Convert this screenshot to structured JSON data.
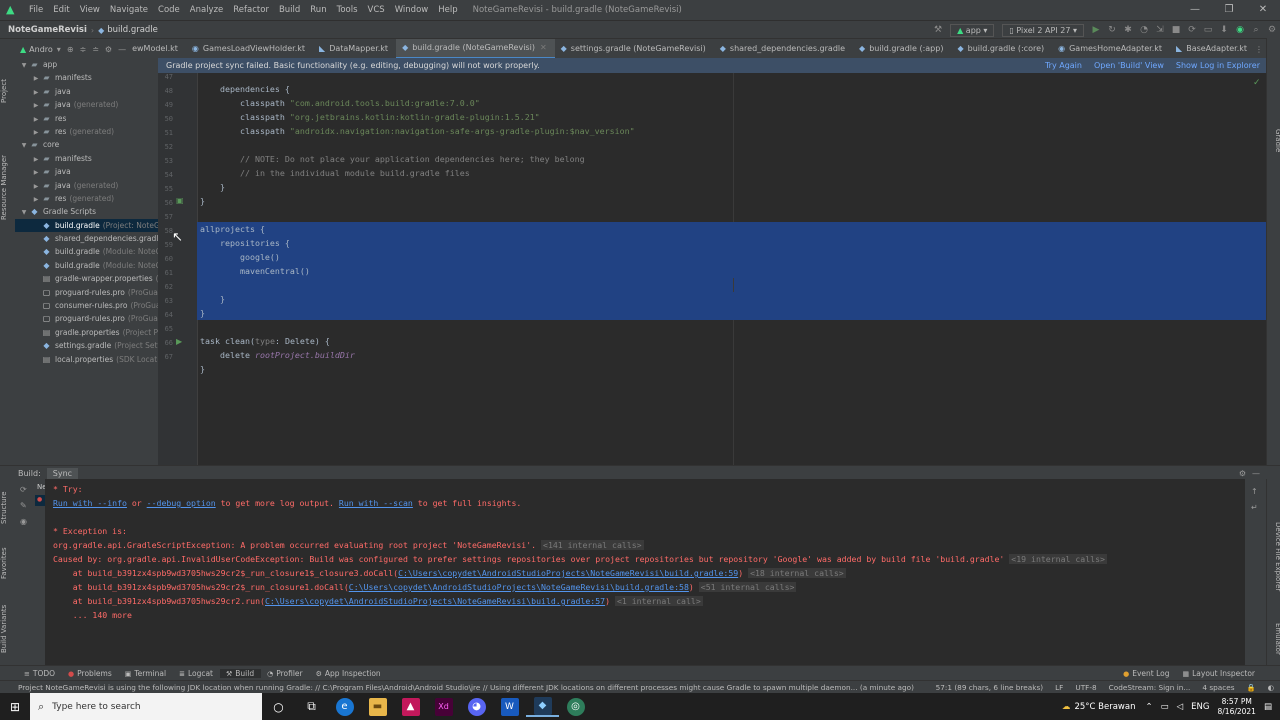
{
  "menubar": {
    "items": [
      "File",
      "Edit",
      "View",
      "Navigate",
      "Code",
      "Analyze",
      "Refactor",
      "Build",
      "Run",
      "Tools",
      "VCS",
      "Window",
      "Help"
    ],
    "window_title": "NoteGameRevisi - build.gradle (NoteGameRevisi)"
  },
  "navbar": {
    "project": "NoteGameRevisi",
    "file": "build.gradle",
    "run_config": "app",
    "device": "Pixel 2 API 27"
  },
  "project_panel": {
    "header": "Andro",
    "rows": [
      {
        "label": "app",
        "sub": "",
        "icon": "folder",
        "indent": 0,
        "expanded": true
      },
      {
        "label": "manifests",
        "sub": "",
        "icon": "folder",
        "indent": 1,
        "expanded": false
      },
      {
        "label": "java",
        "sub": "",
        "icon": "folder",
        "indent": 1,
        "expanded": false
      },
      {
        "label": "java",
        "sub": "(generated)",
        "icon": "folder",
        "indent": 1,
        "expanded": false
      },
      {
        "label": "res",
        "sub": "",
        "icon": "folder",
        "indent": 1,
        "expanded": false
      },
      {
        "label": "res",
        "sub": "(generated)",
        "icon": "folder",
        "indent": 1,
        "expanded": false
      },
      {
        "label": "core",
        "sub": "",
        "icon": "folder",
        "indent": 0,
        "expanded": true
      },
      {
        "label": "manifests",
        "sub": "",
        "icon": "folder",
        "indent": 1,
        "expanded": false
      },
      {
        "label": "java",
        "sub": "",
        "icon": "folder",
        "indent": 1,
        "expanded": false
      },
      {
        "label": "java",
        "sub": "(generated)",
        "icon": "folder",
        "indent": 1,
        "expanded": false
      },
      {
        "label": "res",
        "sub": "(generated)",
        "icon": "folder",
        "indent": 1,
        "expanded": false
      },
      {
        "label": "Gradle Scripts",
        "sub": "",
        "icon": "gradle",
        "indent": 0,
        "expanded": true
      },
      {
        "label": "build.gradle",
        "sub": "(Project: NoteGa",
        "icon": "gradle",
        "indent": 1,
        "selected": true
      },
      {
        "label": "shared_dependencies.gradle",
        "sub": "",
        "icon": "gradle",
        "indent": 1
      },
      {
        "label": "build.gradle",
        "sub": "(Module: NoteG",
        "icon": "gradle",
        "indent": 1
      },
      {
        "label": "build.gradle",
        "sub": "(Module: NoteG",
        "icon": "gradle",
        "indent": 1
      },
      {
        "label": "gradle-wrapper.properties",
        "sub": "(G",
        "icon": "props",
        "indent": 1
      },
      {
        "label": "proguard-rules.pro",
        "sub": "(ProGuar",
        "icon": "file",
        "indent": 1
      },
      {
        "label": "consumer-rules.pro",
        "sub": "(ProGua",
        "icon": "file",
        "indent": 1
      },
      {
        "label": "proguard-rules.pro",
        "sub": "(ProGuar",
        "icon": "file",
        "indent": 1
      },
      {
        "label": "gradle.properties",
        "sub": "(Project Pr",
        "icon": "props",
        "indent": 1
      },
      {
        "label": "settings.gradle",
        "sub": "(Project Settin",
        "icon": "gradle",
        "indent": 1
      },
      {
        "label": "local.properties",
        "sub": "(SDK Location",
        "icon": "props",
        "indent": 1
      }
    ]
  },
  "tabs": [
    {
      "label": "ewModel.kt",
      "icon": "K",
      "active": false
    },
    {
      "label": "GamesLoadViewHolder.kt",
      "icon": "C",
      "active": false
    },
    {
      "label": "DataMapper.kt",
      "icon": "K",
      "active": false
    },
    {
      "label": "build.gradle (NoteGameRevisi)",
      "icon": "G",
      "active": true
    },
    {
      "label": "settings.gradle (NoteGameRevisi)",
      "icon": "G",
      "active": false
    },
    {
      "label": "shared_dependencies.gradle",
      "icon": "G",
      "active": false
    },
    {
      "label": "build.gradle (:app)",
      "icon": "G",
      "active": false
    },
    {
      "label": "build.gradle (:core)",
      "icon": "G",
      "active": false
    },
    {
      "label": "GamesHomeAdapter.kt",
      "icon": "C",
      "active": false
    },
    {
      "label": "BaseAdapter.kt",
      "icon": "K",
      "active": false
    }
  ],
  "banner": {
    "text": "Gradle project sync failed. Basic functionality (e.g. editing, debugging) will not work properly.",
    "try_again": "Try Again",
    "open_build": "Open 'Build' View",
    "show_log": "Show Log in Explorer"
  },
  "editor": {
    "line_numbers": [
      "47",
      "48",
      "49",
      "50",
      "51",
      "52",
      "53",
      "54",
      "55",
      "56",
      "57",
      "58",
      "59",
      "60",
      "61",
      "62",
      "63",
      "64",
      "65",
      "66",
      "67"
    ],
    "lines": [
      {
        "pre": "    ",
        "kw": "dependencies",
        "rest": " {",
        "str": "",
        "tail": ""
      },
      {
        "pre": "        ",
        "kw": "",
        "rest": "classpath ",
        "str": "\"com.android.tools.build:gradle:7.0.0\"",
        "tail": ""
      },
      {
        "pre": "        ",
        "kw": "",
        "rest": "classpath ",
        "str": "\"org.jetbrains.kotlin:kotlin-gradle-plugin:1.5.21\"",
        "tail": ""
      },
      {
        "pre": "        ",
        "kw": "",
        "rest": "classpath ",
        "str": "\"androidx.navigation:navigation-safe-args-gradle-plugin:",
        "tail": "$nav_version\""
      }
    ],
    "comment1": "        // NOTE: Do not place your application dependencies here; they belong",
    "comment2": "        // in the individual module build.gradle files",
    "close_brace_4": "    }",
    "close_brace_0": "}",
    "allprojects": "allprojects {",
    "repositories": "    repositories {",
    "google": "        google()",
    "mavencentral": "        mavenCentral()",
    "repo_close": "    }",
    "all_close": "}",
    "task_kw": "task ",
    "task_name": "clean(",
    "task_param": "type",
    "task_rest": ": Delete) {",
    "delete_kw": "    delete ",
    "delete_val": "rootProject.buildDir",
    "task_close": "}"
  },
  "build_panel": {
    "title": "Build:",
    "sync_tab": "Sync",
    "try_label": "* Try:",
    "run_info_1": "Run with --info",
    "or": " or ",
    "run_debug": "--debug option",
    "more_log": " to get more log output. ",
    "run_scan": "Run with --scan",
    "full_insights": " to get full insights.",
    "exception_label": "* Exception is:",
    "ex1": "org.gradle.api.GradleScriptException: A problem occurred evaluating root project 'NoteGameRevisi'.",
    "ex1_calls": "<141 internal calls>",
    "ex2": "Caused by: org.gradle.api.InvalidUserCodeException: Build was configured to prefer settings repositories over project repositories but repository 'Google' was added by build file 'build.gradle'",
    "ex2_calls": "<19 internal calls>",
    "at1_pre": "    at build_b391zx4spb9wd3705hws29cr2$_run_closure1$_closure3.doCall(",
    "at1_link": "C:\\Users\\copydet\\AndroidStudioProjects\\NoteGameRevisi\\build.gradle:59",
    "at1_calls": "<18 internal calls>",
    "at2_pre": "    at build_b391zx4spb9wd3705hws29cr2$_run_closure1.doCall(",
    "at2_link": "C:\\Users\\copydet\\AndroidStudioProjects\\NoteGameRevisi\\build.gradle:58",
    "at2_calls": "<51 internal calls>",
    "at3_pre": "    at build_b391zx4spb9wd3705hws29cr2.run(",
    "at3_link": "C:\\Users\\copydet\\AndroidStudioProjects\\NoteGameRevisi\\build.gradle:57",
    "at3_calls": "<1 internal call>",
    "more": "    ... 140 more",
    "tree_label": "Ne"
  },
  "left_strip": {
    "project": "Project",
    "resource_manager": "Resource Manager"
  },
  "right_strip": {
    "gradle": "Gradle"
  },
  "bottom_left_strip": {
    "structure": "Structure",
    "favorites": "Favorites",
    "build_variants": "Build Variants"
  },
  "bottom_right_strip": {
    "device_file_explorer": "Device File Explorer",
    "emulator": "Emulator"
  },
  "tool_tabs": [
    {
      "label": "TODO",
      "icon": "≡",
      "on": false
    },
    {
      "label": "Problems",
      "icon": "●",
      "on": false
    },
    {
      "label": "Terminal",
      "icon": "▣",
      "on": false
    },
    {
      "label": "Logcat",
      "icon": "≣",
      "on": false
    },
    {
      "label": "Build",
      "icon": "⚒",
      "on": true
    },
    {
      "label": "Profiler",
      "icon": "◔",
      "on": false
    },
    {
      "label": "App Inspection",
      "icon": "⚙",
      "on": false
    }
  ],
  "tool_tabs_right": [
    {
      "label": "Event Log",
      "icon": "●"
    },
    {
      "label": "Layout Inspector",
      "icon": "▦"
    }
  ],
  "status": {
    "message": "Project NoteGameRevisi is using the following JDK location when running Gradle: // C:\\Program Files\\Android\\Android Studio\\jre // Using different JDK locations on different processes might cause Gradle to spawn multiple daemon... (a minute ago)",
    "position": "57:1 (89 chars, 6 line breaks)",
    "line_sep": "LF",
    "encoding": "UTF-8",
    "codestream": "CodeStream: Sign in...",
    "indent": "4 spaces"
  },
  "taskbar": {
    "search_placeholder": "Type here to search",
    "weather": "25°C  Berawan",
    "lang": "ENG",
    "time": "8:57 PM",
    "date": "8/16/2021"
  },
  "colors": {
    "accent": "#4a88c7",
    "selection": "#214283",
    "banner": "#3d4f66",
    "error": "#ff6b68",
    "link": "#5394ec"
  }
}
